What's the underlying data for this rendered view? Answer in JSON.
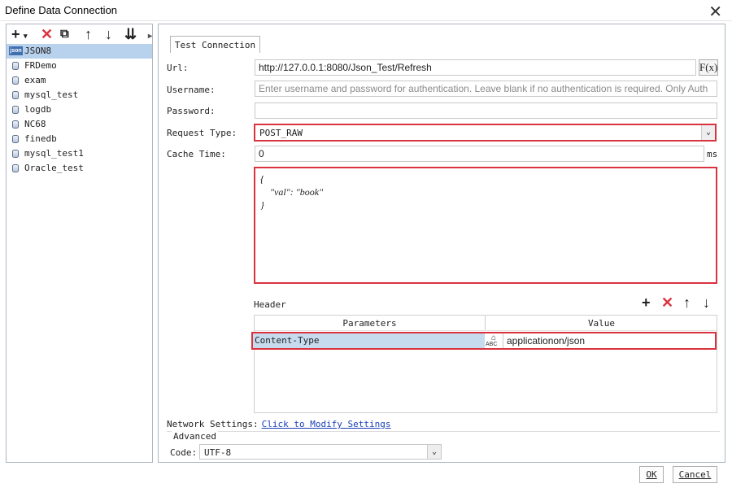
{
  "window": {
    "title": "Define Data Connection"
  },
  "toolbar": {
    "add": "+",
    "add_caret": "▾",
    "delete": "✕",
    "copy": "⧉",
    "up": "↑",
    "down": "↓",
    "sort": "⇊",
    "more": "▸"
  },
  "connections": [
    {
      "name": "JSON8",
      "icon": "json-icon",
      "selected": true
    },
    {
      "name": "FRDemo",
      "icon": "database-icon"
    },
    {
      "name": "exam",
      "icon": "database-icon"
    },
    {
      "name": "mysql_test",
      "icon": "database-icon"
    },
    {
      "name": "logdb",
      "icon": "database-icon"
    },
    {
      "name": "NC68",
      "icon": "database-icon"
    },
    {
      "name": "finedb",
      "icon": "database-icon"
    },
    {
      "name": "mysql_test1",
      "icon": "database-icon"
    },
    {
      "name": "Oracle_test",
      "icon": "database-icon"
    }
  ],
  "form": {
    "test_tab": "Test Connection",
    "url_label": "Url:",
    "url_value": "http://127.0.0.1:8080/Json_Test/Refresh",
    "fx_label": "F(x)",
    "username_label": "Username:",
    "username_placeholder": "Enter username and password for authentication. Leave blank if no authentication is required. Only Auth",
    "password_label": "Password:",
    "password_value": "",
    "request_type_label": "Request Type:",
    "request_type_value": "POST_RAW",
    "cache_label": "Cache Time:",
    "cache_value": "0",
    "cache_unit": "ms",
    "body": "{\n    \"val\": \"book\"\n}"
  },
  "header": {
    "label": "Header",
    "add": "+",
    "delete": "✕",
    "up": "↑",
    "down": "↓",
    "columns": [
      "Parameters",
      "Value"
    ],
    "rows": [
      {
        "param": "Content-Type",
        "value": "applicationon/json"
      }
    ],
    "abc_icon": "ABC"
  },
  "network": {
    "label": "Network Settings:",
    "link": "Click to Modify Settings"
  },
  "advanced": {
    "title": "Advanced",
    "code_label": "Code:",
    "code_value": "UTF-8"
  },
  "buttons": {
    "ok": "OK",
    "cancel": "Cancel"
  },
  "colors": {
    "accent_red": "#d9333f",
    "selection": "#b8d1ed",
    "link": "#1a3fb8"
  }
}
